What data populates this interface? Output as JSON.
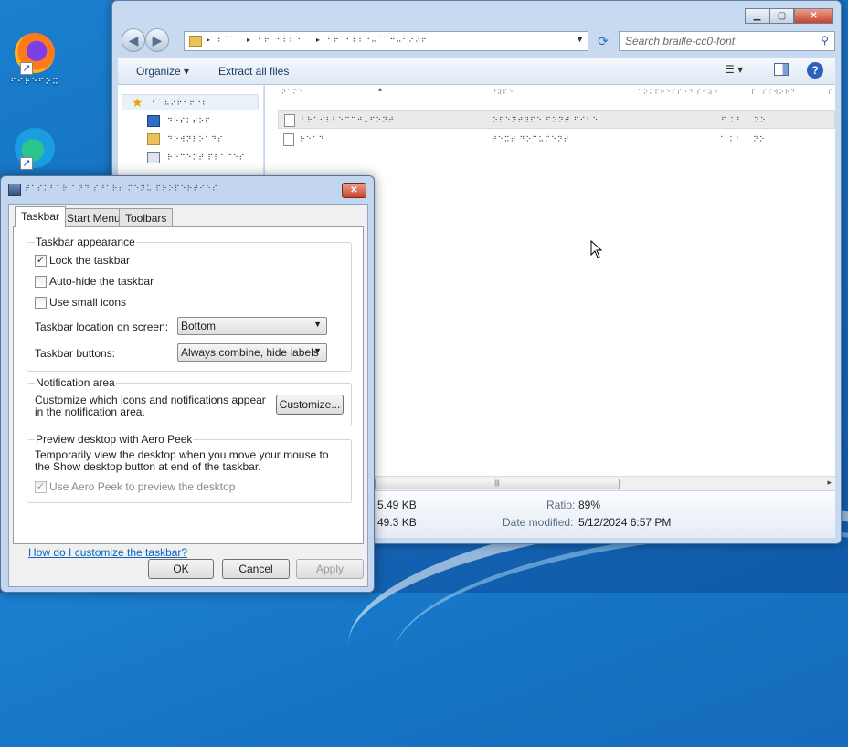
{
  "desktop": {
    "icons": [
      {
        "name": "firefox",
        "label": "⠋⠊⠗⠑⠋⠕⠭"
      },
      {
        "name": "edge",
        "label": ""
      }
    ]
  },
  "explorer": {
    "address_crumbs": [
      "⠇⠉⠁",
      "⠃⠗⠁⠊⠇⠇⠑",
      "⠃⠗⠁⠊⠇⠇⠑⠤⠉⠉⠚⠤⠋⠕⠝⠞"
    ],
    "search_placeholder": "Search braille-cc0-font",
    "toolbar": {
      "organize": "Organize",
      "extract": "Extract all files"
    },
    "nav": [
      {
        "label": "⠋⠁⠧⠕⠗⠊⠞⠑⠎",
        "selected": true
      },
      {
        "label": "⠙⠑⠎⠅⠞⠕⠏",
        "selected": false
      },
      {
        "label": "⠙⠕⠺⠝⠇⠕⠁⠙⠎",
        "selected": false
      },
      {
        "label": "⠗⠑⠉⠑⠝⠞ ⠏⠇⠁⠉⠑⠎",
        "selected": false
      }
    ],
    "columns": [
      "⠝⠁⠍⠑",
      "⠞⠽⠏⠑",
      "⠉⠕⠍⠏⠗⠑⠎⠎⠑⠙ ⠎⠊⠵⠑",
      "⠏⠁⠎⠎⠺⠕⠗⠙",
      "⠎"
    ],
    "files": [
      {
        "name": "⠃⠗⠁⠊⠇⠇⠑⠉⠉⠚⠤⠋⠕⠝⠞",
        "type": "⠕⠏⠑⠝⠞⠽⠏⠑ ⠋⠕⠝⠞ ⠋⠊⠇⠑",
        "size": "⠋ ⠅⠃",
        "extra": "⠝⠕",
        "selected": true
      },
      {
        "name": "⠗⠑⠁⠙",
        "type": "⠞⠑⠭⠞ ⠙⠕⠉⠥⠍⠑⠝⠞",
        "size": "⠁ ⠅⠃",
        "extra": "⠝⠕",
        "selected": false
      }
    ],
    "details": {
      "size1": "5.49 KB",
      "size2": "49.3 KB",
      "ratio_label": "Ratio:",
      "ratio_value": "89%",
      "date_label": "Date modified:",
      "date_value": "5/12/2024 6:57 PM"
    }
  },
  "dialog": {
    "title": "⠞⠁⠎⠅⠃⠁⠗ ⠁⠝⠙ ⠎⠞⠁⠗⠞ ⠍⠑⠝⠥ ⠏⠗⠕⠏⠑⠗⠞⠊⠑⠎",
    "tabs": [
      "Taskbar",
      "Start Menu",
      "Toolbars"
    ],
    "appearance": {
      "title": "Taskbar appearance",
      "lock": "Lock the taskbar",
      "lock_checked": true,
      "autohide": "Auto-hide the taskbar",
      "small_icons": "Use small icons",
      "location_label": "Taskbar location on screen:",
      "location_value": "Bottom",
      "buttons_label": "Taskbar buttons:",
      "buttons_value": "Always combine, hide labels"
    },
    "notification": {
      "title": "Notification area",
      "text": "Customize which icons and notifications appear in the notification area.",
      "button": "Customize..."
    },
    "peek": {
      "title": "Preview desktop with Aero Peek",
      "text": "Temporarily view the desktop when you move your mouse to the Show desktop button at end of the taskbar.",
      "checkbox": "Use Aero Peek to preview the desktop"
    },
    "help_link": "How do I customize the taskbar?",
    "buttons": {
      "ok": "OK",
      "cancel": "Cancel",
      "apply": "Apply"
    }
  }
}
